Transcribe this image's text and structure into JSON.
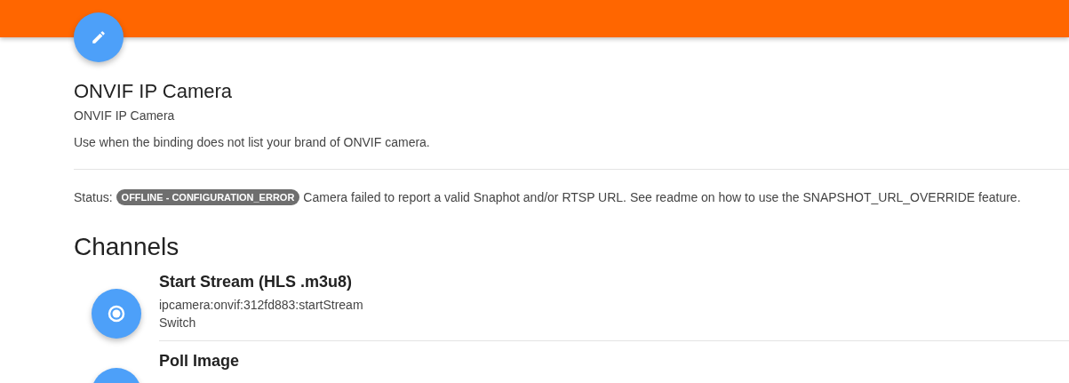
{
  "thing": {
    "title": "ONVIF IP Camera",
    "label": "ONVIF IP Camera",
    "description": "Use when the binding does not list your brand of ONVIF camera."
  },
  "status": {
    "label": "Status:",
    "badge": "OFFLINE - CONFIGURATION_ERROR",
    "message": "Camera failed to report a valid Snaphot and/or RTSP URL. See readme on how to use the SNAPSHOT_URL_OVERRIDE feature."
  },
  "channels_heading": "Channels",
  "channels": [
    {
      "title": "Start Stream (HLS .m3u8)",
      "uid": "ipcamera:onvif:312fd883:startStream",
      "type": "Switch"
    },
    {
      "title": "Poll Image"
    }
  ]
}
